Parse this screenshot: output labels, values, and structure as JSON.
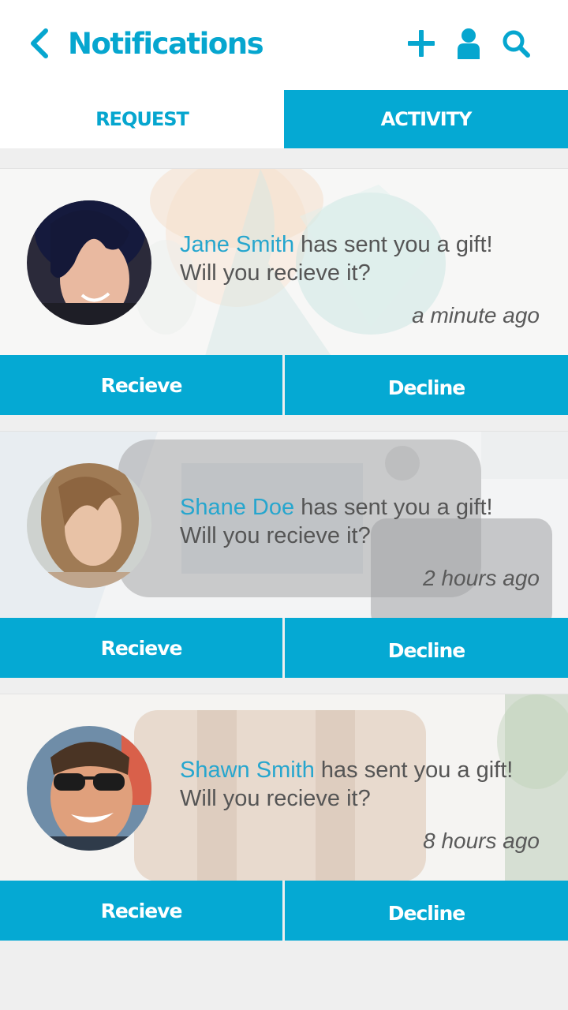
{
  "header": {
    "title": "Notifications",
    "back_icon": "chevron-left-icon",
    "add_icon": "plus-icon",
    "user_icon": "user-icon",
    "search_icon": "search-icon",
    "accent_color": "#06a6cf"
  },
  "tabs": [
    {
      "label": "REQUEST",
      "active": false
    },
    {
      "label": "ACTIVITY",
      "active": true
    }
  ],
  "notifications": [
    {
      "sender": "Jane Smith",
      "message": "has sent you a gift!",
      "question": "Will you recieve it?",
      "time": "a minute ago",
      "accept_label": "Recieve",
      "decline_label": "Decline"
    },
    {
      "sender": "Shane Doe",
      "message": "has sent you a gift!",
      "question": "Will you recieve it?",
      "time": "2 hours ago",
      "accept_label": "Recieve",
      "decline_label": "Decline"
    },
    {
      "sender": "Shawn Smith",
      "message": "has sent you a gift!",
      "question": "Will you recieve it?",
      "time": "8 hours ago",
      "accept_label": "Recieve",
      "decline_label": "Decline"
    }
  ],
  "colors": {
    "button_bg": "#05a9d3",
    "name_text": "#26a6ce",
    "page_bg": "#efefef"
  }
}
